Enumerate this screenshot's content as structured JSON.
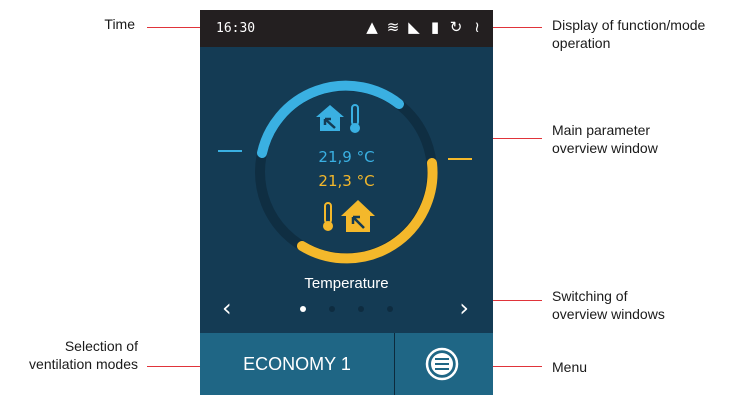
{
  "device": {
    "time": "16:30",
    "status_icons": [
      "warning-icon",
      "defrost-icon",
      "boost-icon",
      "luggage-icon",
      "recirculation-icon",
      "heater-icon"
    ],
    "overview": {
      "indoor_temperature": "21,9 °C",
      "outdoor_temperature": "21,3 °C",
      "indoor_color": "#3ab0e2",
      "outdoor_color": "#f4b82b",
      "window_title": "Temperature",
      "page_count": 4,
      "active_page": 1
    },
    "nav": {
      "prev": "‹",
      "next": "›"
    },
    "mode_label": "ECONOMY 1",
    "menu_icon": "menu-icon"
  },
  "callouts": {
    "time": "Time",
    "function_display_line1": "Display of function/mode",
    "function_display_line2": "operation",
    "main_window_line1": "Main parameter",
    "main_window_line2": "overview window",
    "switching_line1": "Switching of",
    "switching_line2": "overview windows",
    "modes_line1": "Selection of",
    "modes_line2": "ventilation modes",
    "menu": "Menu"
  },
  "colors": {
    "leader": "#e0343a",
    "background": "#143b54",
    "buttons": "#1f6685"
  }
}
